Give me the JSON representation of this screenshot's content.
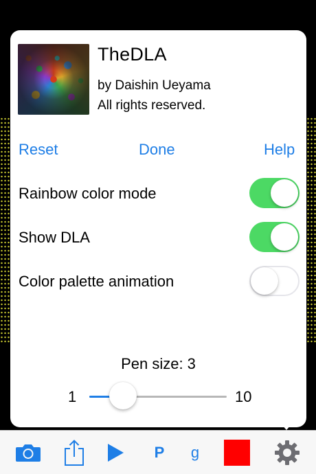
{
  "app": {
    "title": "TheDLA",
    "author": "by Daishin Ueyama",
    "rights": "All rights reserved."
  },
  "actions": {
    "reset_label": "Reset",
    "done_label": "Done",
    "help_label": "Help"
  },
  "settings": [
    {
      "label": "Rainbow color mode",
      "enabled": true
    },
    {
      "label": "Show DLA",
      "enabled": true
    },
    {
      "label": "Color palette animation",
      "enabled": false
    }
  ],
  "pen": {
    "label": "Pen size: 3",
    "min_label": "1",
    "max_label": "10",
    "min": 1,
    "max": 10,
    "value": 3
  },
  "toolbar": {
    "camera_icon": "camera-icon",
    "share_icon": "share-icon",
    "play_icon": "play-icon",
    "p_label": "P",
    "g_label": "g",
    "color_swatch": "#ff0000",
    "settings_icon": "gear-icon"
  },
  "colors": {
    "accent": "#1e7ee6",
    "toggle_on": "#4cd964",
    "swatch": "#ff0000",
    "gear": "#6d6d72"
  }
}
